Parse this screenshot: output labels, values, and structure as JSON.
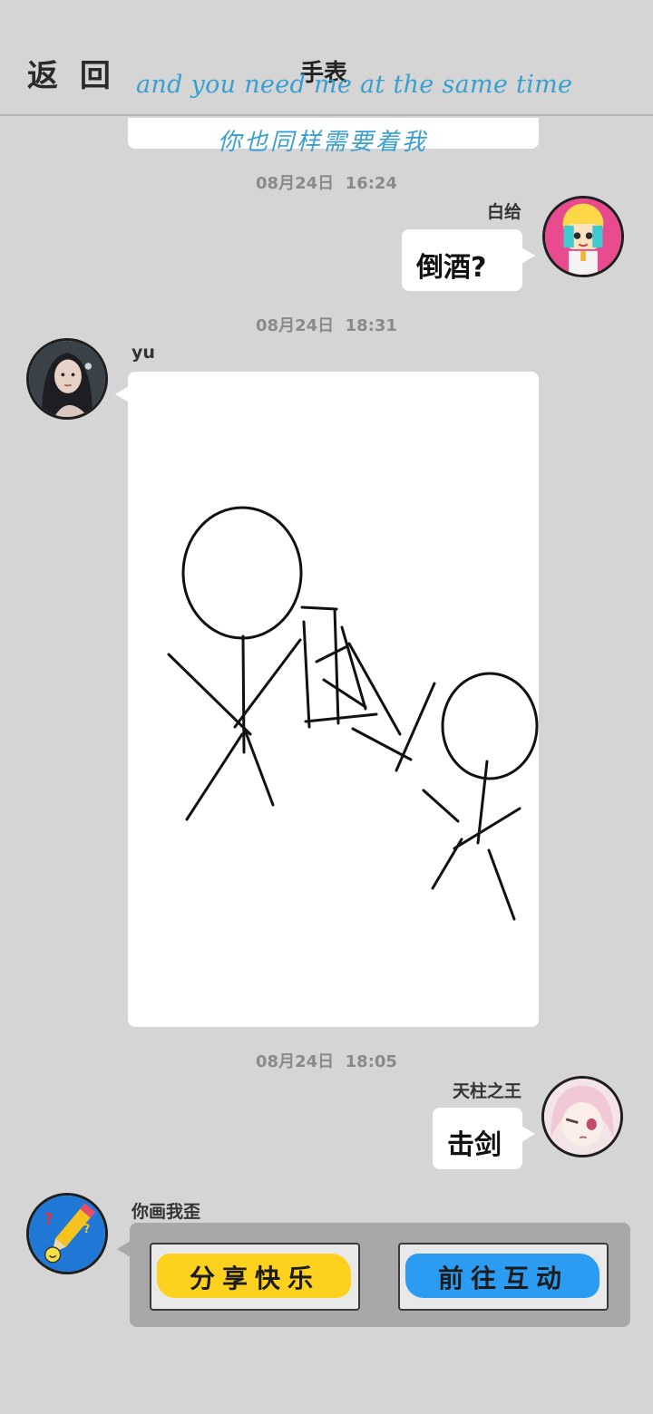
{
  "header": {
    "back_label": "返 回",
    "title": "手表"
  },
  "lyrics": {
    "english": "and you need me at the same time",
    "chinese": "你也同样需要着我"
  },
  "messages": [
    {
      "timestamp": "08月24日  16:24",
      "sender": "白给",
      "text": "倒酒?",
      "side": "right"
    },
    {
      "timestamp": "08月24日  18:31",
      "sender": "yu",
      "type": "drawing",
      "side": "left"
    },
    {
      "timestamp": "08月24日  18:05",
      "sender": "天柱之王",
      "text": "击剑",
      "side": "right"
    }
  ],
  "game_card": {
    "sender": "你画我歪",
    "buttons": [
      {
        "label": "分享快乐",
        "color": "#fcd21e"
      },
      {
        "label": "前往互动",
        "color": "#2b9cf2"
      }
    ]
  },
  "colors": {
    "background": "#d5d5d5",
    "lyric": "#3a9fd0",
    "timestamp": "#8a8a8a",
    "card": "#a8a8a8"
  },
  "icons": {
    "avatar_1": "anime-girl-avatar",
    "avatar_2": "woman-portrait-avatar",
    "avatar_3": "pink-hair-anime-avatar",
    "avatar_4": "pencil-game-avatar"
  }
}
